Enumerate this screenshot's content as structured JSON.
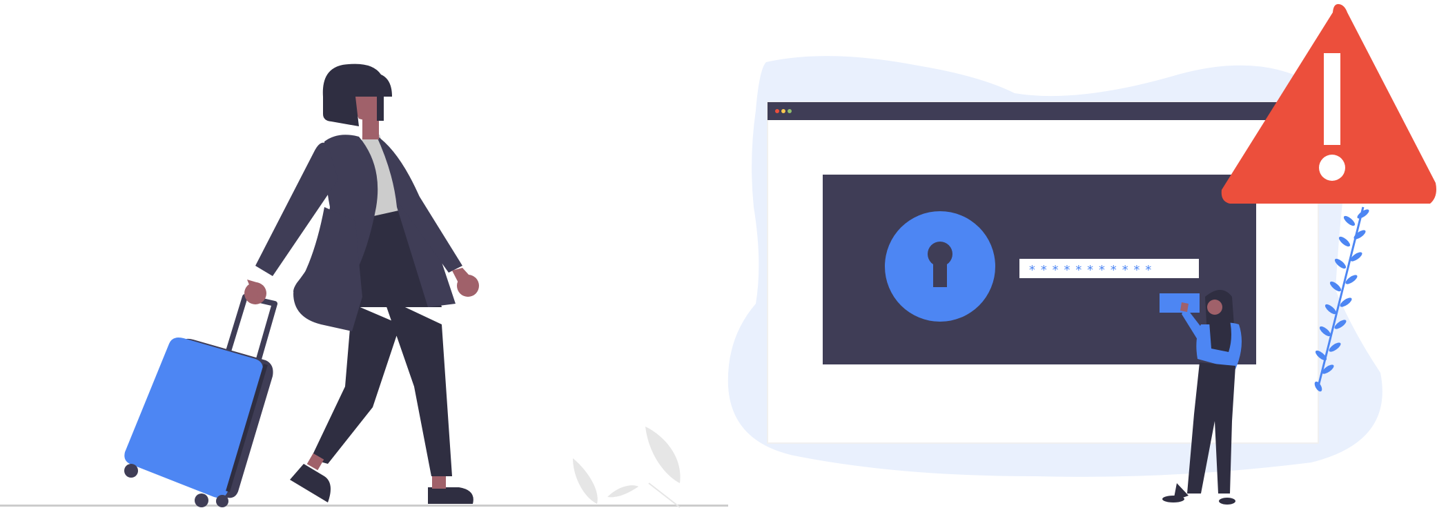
{
  "illustrations": {
    "traveler": {
      "description_icon": "woman-with-suitcase-illustration"
    },
    "security": {
      "description_icon": "locked-login-warning-illustration"
    }
  },
  "login_panel": {
    "password_mask": "***********"
  },
  "colors": {
    "accent_blue": "#4d86f3",
    "dark_navy": "#3f3d56",
    "suit_dark": "#2f2e41",
    "skin": "#a0616a",
    "warning_red": "#ec4f3c",
    "blob_light": "#e9f0fd",
    "leaf_gray": "#e6e6e6",
    "ground_gray": "#cccccc"
  }
}
